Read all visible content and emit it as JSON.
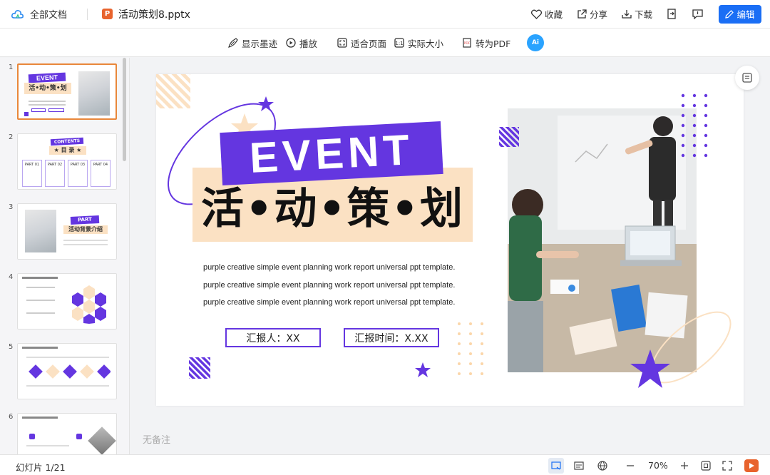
{
  "header": {
    "all_docs": "全部文档",
    "file_icon_letter": "P",
    "file_name": "活动策划8.pptx",
    "actions": {
      "favorite": "收藏",
      "share": "分享",
      "download": "下载",
      "edit": "编辑"
    }
  },
  "toolbar": {
    "show_ink": "显示墨迹",
    "play": "播放",
    "fit_page": "适合页面",
    "actual_size": "实际大小",
    "to_pdf": "转为PDF",
    "ai_label": "Ai"
  },
  "sidebar": {
    "slides": [
      {
        "num": "1",
        "active": true,
        "title_top": "EVENT",
        "title_bottom": "活•动•策•划"
      },
      {
        "num": "2",
        "active": false,
        "badge": "CONTENTS",
        "heading": "★ 目 录 ★",
        "parts": [
          "PART 01",
          "PART 02",
          "PART 03",
          "PART 04"
        ]
      },
      {
        "num": "3",
        "active": false,
        "badge": "PART",
        "heading": "活动背景介绍"
      },
      {
        "num": "4",
        "active": false
      },
      {
        "num": "5",
        "active": false
      },
      {
        "num": "6",
        "active": false
      }
    ]
  },
  "slide": {
    "event": "EVENT",
    "title": "活•动•策•划",
    "descriptions": [
      "purple creative simple event planning work report universal ppt template.",
      "purple creative simple event planning work report universal ppt template.",
      "purple creative simple event planning work report universal ppt template."
    ],
    "reporter": "汇报人：XX",
    "report_time": "汇报时间：X.XX"
  },
  "notes": "无备注",
  "status": {
    "page": "幻灯片 1/21",
    "zoom": "70%"
  },
  "colors": {
    "accent_blue": "#1a6ef5",
    "brand_purple": "#6436e0",
    "peach": "#fbe1c3",
    "orange": "#e8632d"
  }
}
